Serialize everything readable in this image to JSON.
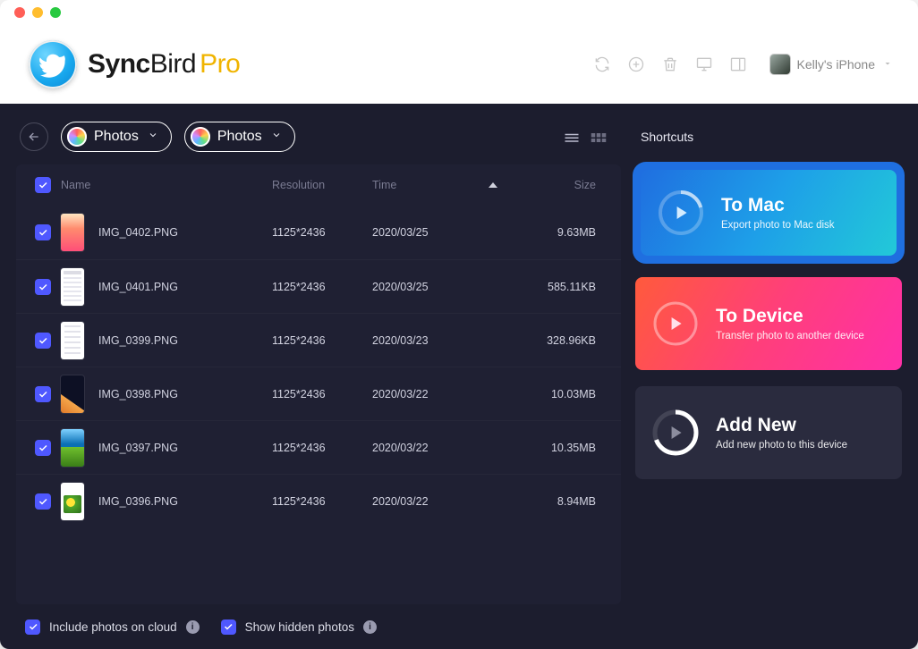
{
  "brand": {
    "a": "Sync",
    "b": "Bird",
    "pro": "Pro"
  },
  "device": {
    "name": "Kelly's iPhone"
  },
  "breadcrumbs": {
    "a": "Photos",
    "b": "Photos"
  },
  "shortcuts_label": "Shortcuts",
  "columns": {
    "name": "Name",
    "resolution": "Resolution",
    "time": "Time",
    "size": "Size"
  },
  "rows": [
    {
      "name": "IMG_0402.PNG",
      "res": "1125*2436",
      "time": "2020/03/25",
      "size": "9.63MB",
      "thumb": "th0"
    },
    {
      "name": "IMG_0401.PNG",
      "res": "1125*2436",
      "time": "2020/03/25",
      "size": "585.11KB",
      "thumb": "th1"
    },
    {
      "name": "IMG_0399.PNG",
      "res": "1125*2436",
      "time": "2020/03/23",
      "size": "328.96KB",
      "thumb": "th2"
    },
    {
      "name": "IMG_0398.PNG",
      "res": "1125*2436",
      "time": "2020/03/22",
      "size": "10.03MB",
      "thumb": "th3"
    },
    {
      "name": "IMG_0397.PNG",
      "res": "1125*2436",
      "time": "2020/03/22",
      "size": "10.35MB",
      "thumb": "th4"
    },
    {
      "name": "IMG_0396.PNG",
      "res": "1125*2436",
      "time": "2020/03/22",
      "size": "8.94MB",
      "thumb": "th5"
    }
  ],
  "cards": {
    "mac": {
      "title": "To Mac",
      "sub": "Export photo to Mac disk"
    },
    "device": {
      "title": "To Device",
      "sub": "Transfer photo to another device"
    },
    "add": {
      "title": "Add New",
      "sub": "Add new photo to this device"
    }
  },
  "footer": {
    "cloud": "Include photos on cloud",
    "hidden": "Show hidden photos"
  }
}
